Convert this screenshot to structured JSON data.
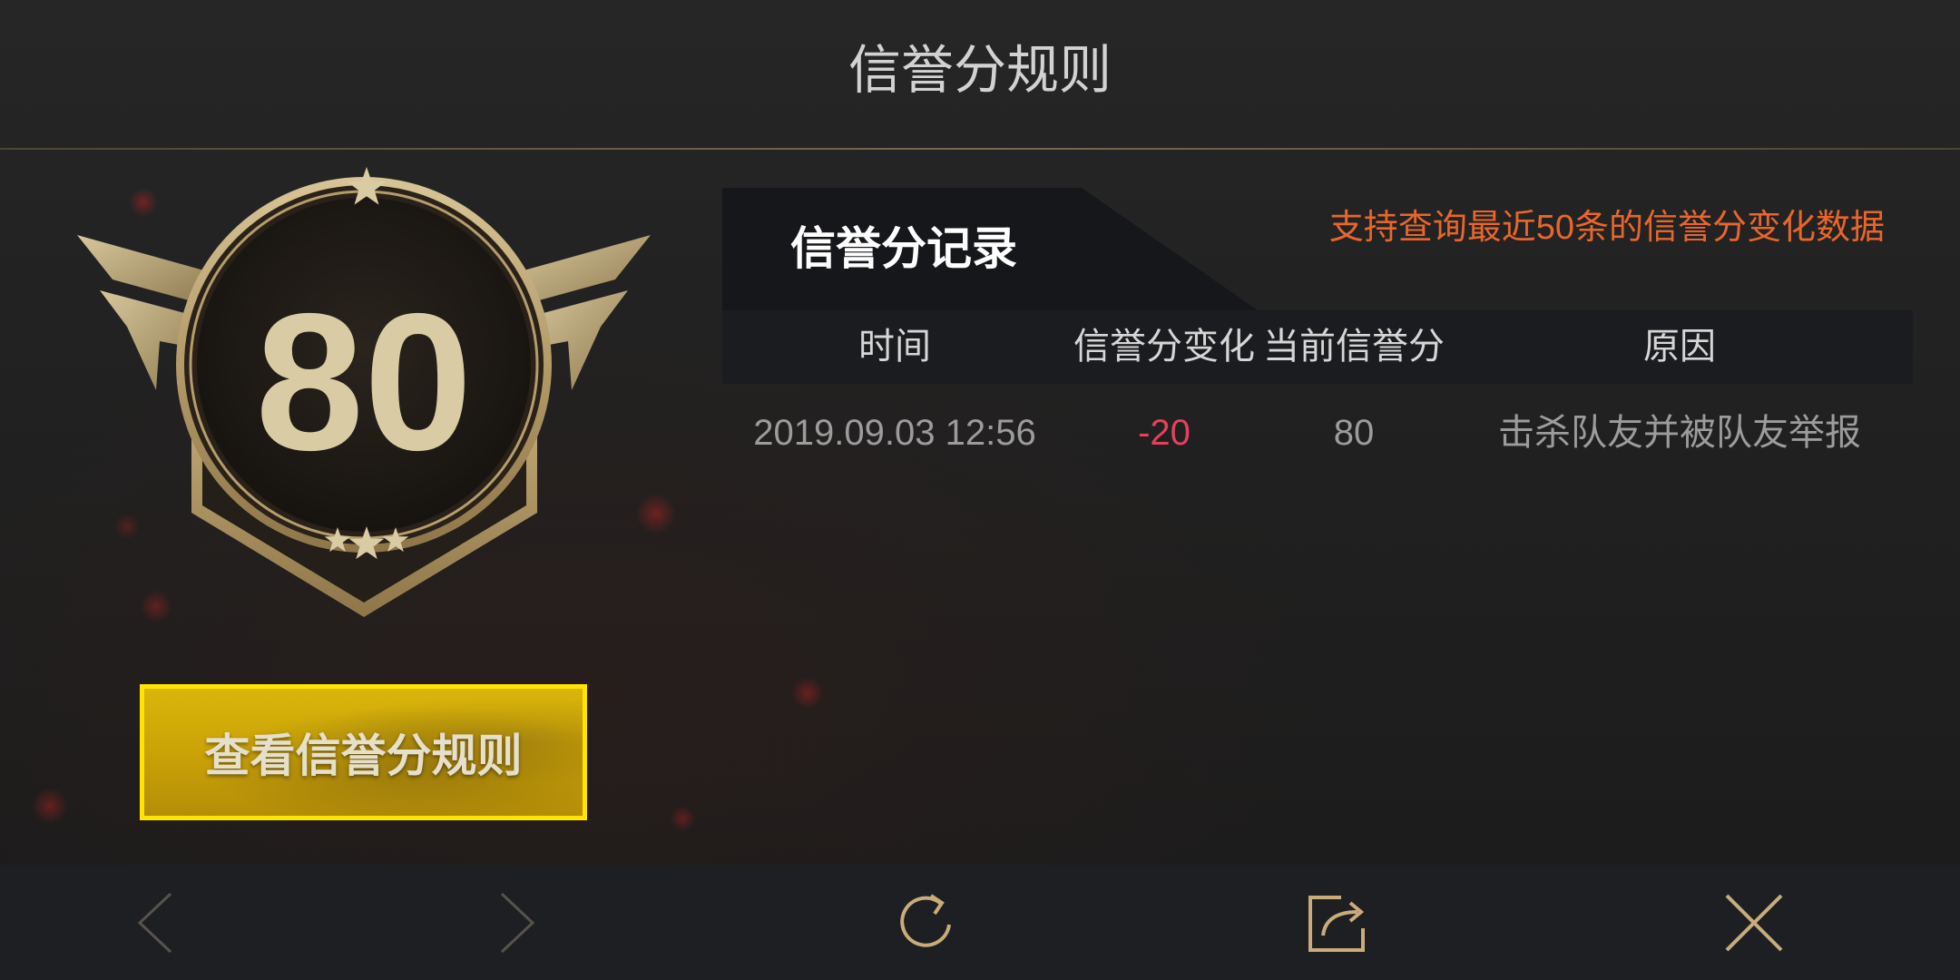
{
  "header": {
    "title": "信誉分规则"
  },
  "badge": {
    "score": "80"
  },
  "rules_button": {
    "label": "查看信誉分规则"
  },
  "records": {
    "tab_label": "信誉分记录",
    "note": "支持查询最近50条的信誉分变化数据",
    "columns": [
      "时间",
      "信誉分变化",
      "当前信誉分",
      "原因"
    ],
    "rows": [
      {
        "time": "2019.09.03 12:56",
        "change": "-20",
        "current": "80",
        "reason": "击杀队友并被队友举报"
      }
    ]
  },
  "nav": {
    "items": [
      "chevron-left-icon",
      "chevron-right-icon",
      "refresh-icon",
      "share-icon",
      "close-icon"
    ]
  },
  "colors": {
    "gold": "#c8ad7a",
    "note_orange": "#e8662c",
    "negative_red": "#e5415c",
    "button_yellow": "#ffe400"
  }
}
